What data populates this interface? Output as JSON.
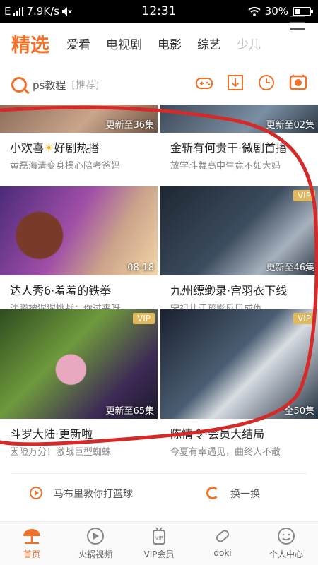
{
  "status_bar": {
    "signal": "E",
    "speed": "7.9K/s",
    "time": "12:31",
    "battery": "30%",
    "battery_level": 0.3
  },
  "tabs": [
    "精选",
    "爱看",
    "电视剧",
    "电影",
    "综艺",
    "少儿"
  ],
  "search": {
    "query": "ps教程",
    "tag": "[推荐]"
  },
  "cards": [
    {
      "title": "小欢喜",
      "title_icon": "sun-icon",
      "title_suffix": "好剧热播",
      "subtitle": "黄磊海清变身操心陪考爸妈",
      "badge": "更新至36集",
      "vip": ""
    },
    {
      "title": "金斩有何贵干·微剧首播",
      "subtitle": "放学斗舞高中生竟不如大妈",
      "badge": "更新至02集",
      "vip": ""
    },
    {
      "title": "达人秀6·羞羞的铁拳",
      "subtitle": "沈腾被猩猩挑战：你过来呀",
      "badge": "08-18",
      "vip": ""
    },
    {
      "title": "九州缥缈录·宫羽衣下线",
      "subtitle": "宋祖儿江疏影反目成仇",
      "badge": "更新至46集",
      "vip": "VIP"
    },
    {
      "title": "斗罗大陆·更新啦",
      "subtitle": "因险万分！激战巨型蜘蛛",
      "badge": "更新至65集",
      "vip": "VIP"
    },
    {
      "title": "陈情令·会员大结局",
      "subtitle": "今夏有幸遇见，曲终人不散",
      "badge": "全50集",
      "vip": "VIP"
    }
  ],
  "bottom_row": {
    "teach_label": "马布里教你打篮球",
    "refresh_label": "换一换"
  },
  "nav": [
    "首页",
    "火锅视频",
    "VIP会员",
    "doki",
    "个人中心"
  ],
  "colors": {
    "accent": "#f0722a",
    "vip_badge": "#e1b85b",
    "annotation": "#d42a2a"
  }
}
